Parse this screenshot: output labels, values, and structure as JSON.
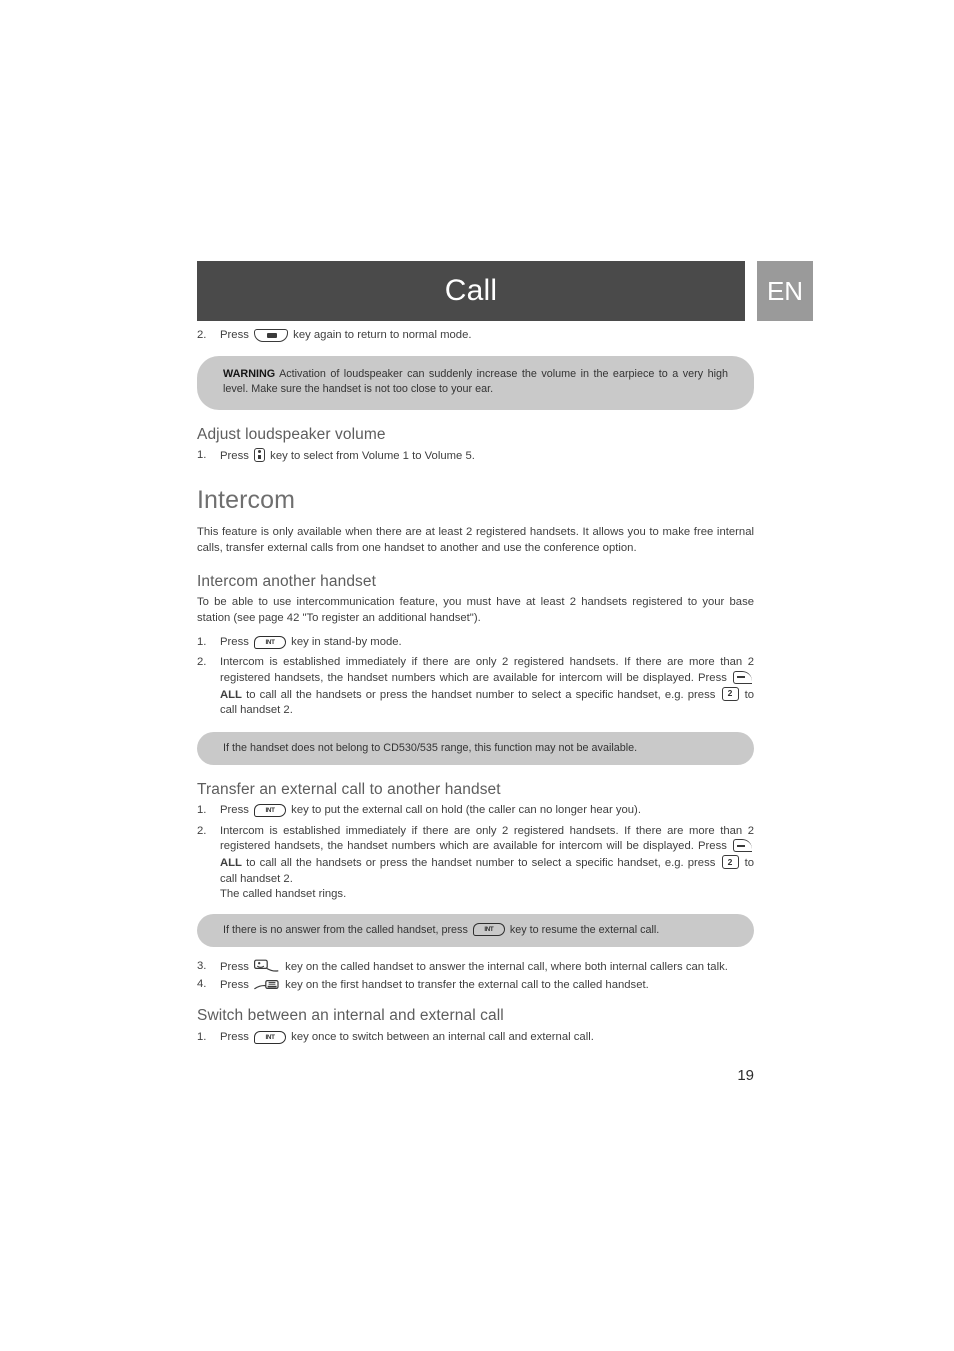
{
  "header": {
    "title": "Call",
    "language_badge": "EN",
    "bar_color": "#4a4a4a",
    "badge_color": "#9a9a9a"
  },
  "page_number": "19",
  "icons": {
    "speaker_key": "loudspeaker-key-icon",
    "volume_key": "volume-updown-key-icon",
    "int_key": "intercom-key-icon",
    "int_key_label": "INT",
    "softkey_all": "left-softkey-icon",
    "handset_number_key": "handset-2-key-icon",
    "handset_number_label": "2",
    "talk_key": "talk-offhook-key-icon",
    "end_key": "end-onhook-key-icon"
  },
  "sections": {
    "step_top": {
      "num": "2.",
      "before": "Press",
      "after": "key again to return to normal mode."
    },
    "warning": {
      "label": "WARNING",
      "text": "Activation of loudspeaker can suddenly increase the volume in the earpiece to a very high level. Make sure the handset is not too close to your ear."
    },
    "adjust_volume": {
      "heading": "Adjust loudspeaker volume",
      "step1_num": "1.",
      "step1_before": "Press",
      "step1_after": "key to select from Volume 1 to Volume 5."
    },
    "intercom": {
      "heading": "Intercom",
      "intro": "This feature is only available when there are at least 2 registered handsets. It allows you to make free internal calls, transfer external calls from one handset to another and use the conference option."
    },
    "intercom_another": {
      "heading": "Intercom another handset",
      "intro": "To be able to use intercommunication feature, you must have at least 2 handsets registered to your base station (see page 42 \"To register an additional handset\").",
      "step1_num": "1.",
      "step1_before": "Press",
      "step1_after": "key in stand-by mode.",
      "step2_num": "2.",
      "step2_part1": "Intercom is established immediately if there are only 2 registered handsets. If there are more than 2 registered handsets, the handset numbers which are available for intercom will be displayed. Press",
      "step2_all": "ALL",
      "step2_part2": "to call all the handsets or press the handset number to select a specific handset, e.g. press",
      "step2_part3": "to call handset 2."
    },
    "note_range": {
      "text": "If the handset does not belong to CD530/535 range, this function may not be available."
    },
    "transfer": {
      "heading": "Transfer an external call to another handset",
      "step1_num": "1.",
      "step1_before": "Press",
      "step1_after": "key to put the external call on hold (the caller can no longer hear you).",
      "step2_num": "2.",
      "step2_part1": "Intercom is established immediately if there are only 2 registered handsets. If there are more than 2 registered handsets, the handset numbers which are available for intercom will be displayed. Press",
      "step2_all": "ALL",
      "step2_part2": "to call all the handsets or press the handset number to select a specific handset, e.g. press",
      "step2_part3": "to call handset 2.",
      "step2_part4": "The called handset rings.",
      "step3_num": "3.",
      "step3_before": "Press",
      "step3_after": "key on the called handset to answer the internal call, where both internal callers can talk.",
      "step4_num": "4.",
      "step4_before": "Press",
      "step4_after": "key on the first handset to transfer the external call to the called handset."
    },
    "note_no_answer": {
      "before": "If there is no answer from the called handset, press",
      "after": "key to resume the external call."
    },
    "switch_call": {
      "heading": "Switch between an internal and external call",
      "step1_num": "1.",
      "step1_before": "Press",
      "step1_after": "key once to switch between an internal call and external call."
    }
  }
}
